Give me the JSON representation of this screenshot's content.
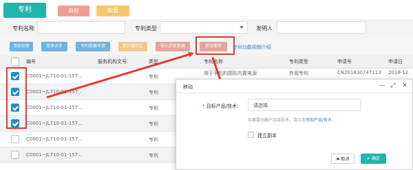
{
  "tabs": [
    {
      "label": "专利",
      "color": "#1fb5ad"
    },
    {
      "label": "商标",
      "color": "#f49c94"
    },
    {
      "label": "软著",
      "color": "#f6c86b"
    }
  ],
  "search": {
    "name_label": "专利名称",
    "type_label": "专利类型",
    "inventor_label": "发明人"
  },
  "toolbar": {
    "buttons": [
      {
        "label": "添加创意",
        "color": "#6fb3e0"
      },
      {
        "label": "竞争对手",
        "color": "#6fb3e0"
      },
      {
        "label": "专利检索申请",
        "color": "#6fb3e0"
      },
      {
        "label": "案件操作台",
        "color": "#f0c98a"
      },
      {
        "label": "导入历史数据",
        "color": "#e4a49d"
      },
      {
        "label": "移动案件",
        "color": "#e4a49d"
      }
    ],
    "link": "专利功能视频介绍"
  },
  "table": {
    "headers": [
      "编号",
      "服务机构文号",
      "类型",
      "专利名称",
      "专利类型",
      "申请号",
      "申请日"
    ],
    "rows": [
      {
        "checked": true,
        "id": "C0001~JL710-01-157...",
        "type": "专利",
        "name": "用于手机的圆形内置电源",
        "ptype": "外观专利",
        "appno": "CN201830747113",
        "date": "2018-12"
      },
      {
        "checked": true,
        "id": "C0001~JL710-01-157...",
        "type": "专利"
      },
      {
        "checked": true,
        "id": "C0001~JL710-01-157...",
        "type": "专利"
      },
      {
        "checked": true,
        "id": "C0001~JL710-01-157...",
        "type": "专利"
      },
      {
        "checked": false,
        "id": "C0001~JL710-01-157...",
        "type": "专利"
      },
      {
        "checked": false,
        "id": "C0001~JL710-01-157...",
        "type": "专利"
      }
    ]
  },
  "modal": {
    "title": "移动",
    "field_label": "目标产品/技术:",
    "required_mark": "*",
    "select_placeholder": "请选择",
    "hint_prefix": "如果要创建产品或技术，请点击",
    "hint_link": "添加产品/技术",
    "copy_label": "建立副本",
    "cancel_label": "✖ 取消",
    "ok_label": "✔ 确定",
    "min_icon": "—",
    "max_icon": "⤢",
    "close_icon": "✕"
  },
  "highlight_color": "#e8372c"
}
